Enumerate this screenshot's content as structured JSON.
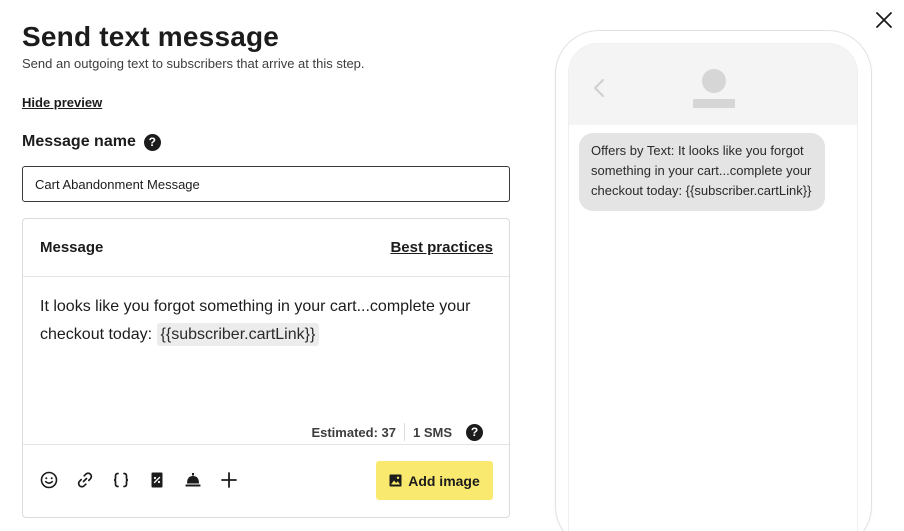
{
  "header": {
    "title": "Send text message",
    "subtitle": "Send an outgoing text to subscribers that arrive at this step.",
    "hide_preview": "Hide preview",
    "close_icon": "close-icon"
  },
  "message_name": {
    "label": "Message name",
    "help_glyph": "?",
    "value": "Cart Abandonment Message"
  },
  "message": {
    "heading": "Message",
    "best_practices": "Best practices",
    "body_text": "It looks like you forgot something in your cart...complete your checkout today:",
    "token": "{{subscriber.cartLink}}",
    "estimated": "Estimated: 37",
    "sms_count": "1 SMS",
    "help_glyph": "?",
    "toolbar": {
      "icons": [
        "emoji-icon",
        "link-icon",
        "variable-braces-icon",
        "coupon-icon",
        "concierge-bell-icon",
        "plus-icon"
      ],
      "add_image": "Add image"
    }
  },
  "preview": {
    "bubble_text": "Offers by Text: It looks like you forgot something in your cart...complete your checkout today: {{subscriber.cartLink}}"
  },
  "colors": {
    "accent_button": "#f9ea6f",
    "token_bg": "#ececec",
    "bubble_bg": "#e4e4e4",
    "phone_header_bg": "#f4f4f4"
  }
}
